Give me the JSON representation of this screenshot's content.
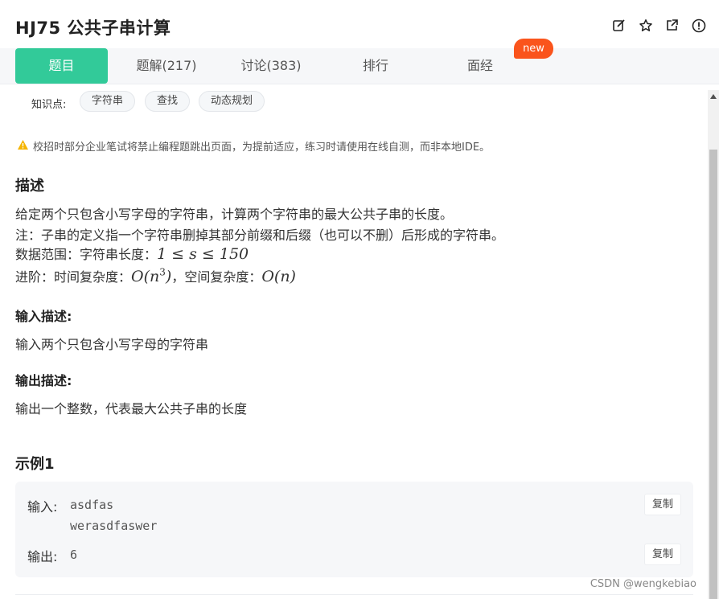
{
  "header": {
    "title": "HJ75  公共子串计算",
    "icons": [
      "edit-icon",
      "star-icon",
      "external-link-icon",
      "info-icon"
    ]
  },
  "tabs": [
    {
      "label": "题目",
      "active": true
    },
    {
      "label": "题解(217)",
      "active": false
    },
    {
      "label": "讨论(383)",
      "active": false
    },
    {
      "label": "排行",
      "active": false
    },
    {
      "label": "面经",
      "active": false
    }
  ],
  "new_badge": "new",
  "knowledge": {
    "label": "知识点:",
    "tags": [
      "字符串",
      "查找",
      "动态规划"
    ]
  },
  "warning": "校招时部分企业笔试将禁止编程题跳出页面，为提前适应，练习时请使用在线自测，而非本地IDE。",
  "description": {
    "heading": "描述",
    "line1": "给定两个只包含小写字母的字符串，计算两个字符串的最大公共子串的长度。",
    "line2": "注：子串的定义指一个字符串删掉其部分前缀和后缀（也可以不删）后形成的字符串。",
    "line3_prefix": "数据范围：字符串长度：",
    "line3_math": "1 ≤ s ≤ 150",
    "line4_prefix": "进阶：时间复杂度：",
    "line4_math1": "O(n",
    "line4_math1_sup": "3",
    "line4_math1_close": ")",
    "line4_mid": "，空间复杂度：",
    "line4_math2": "O(n)"
  },
  "input_desc": {
    "heading": "输入描述:",
    "text": "输入两个只包含小写字母的字符串"
  },
  "output_desc": {
    "heading": "输出描述:",
    "text": "输出一个整数，代表最大公共子串的长度"
  },
  "example": {
    "heading": "示例1",
    "input_label": "输入:",
    "input_line1": "asdfas",
    "input_line2": "werasdfaswer",
    "output_label": "输出:",
    "output_value": "6",
    "copy_label": "复制"
  },
  "watermark": "CSDN @wengkebiao",
  "colors": {
    "accent": "#32ca99",
    "badge": "#fa541c",
    "warning": "#f5b400"
  }
}
